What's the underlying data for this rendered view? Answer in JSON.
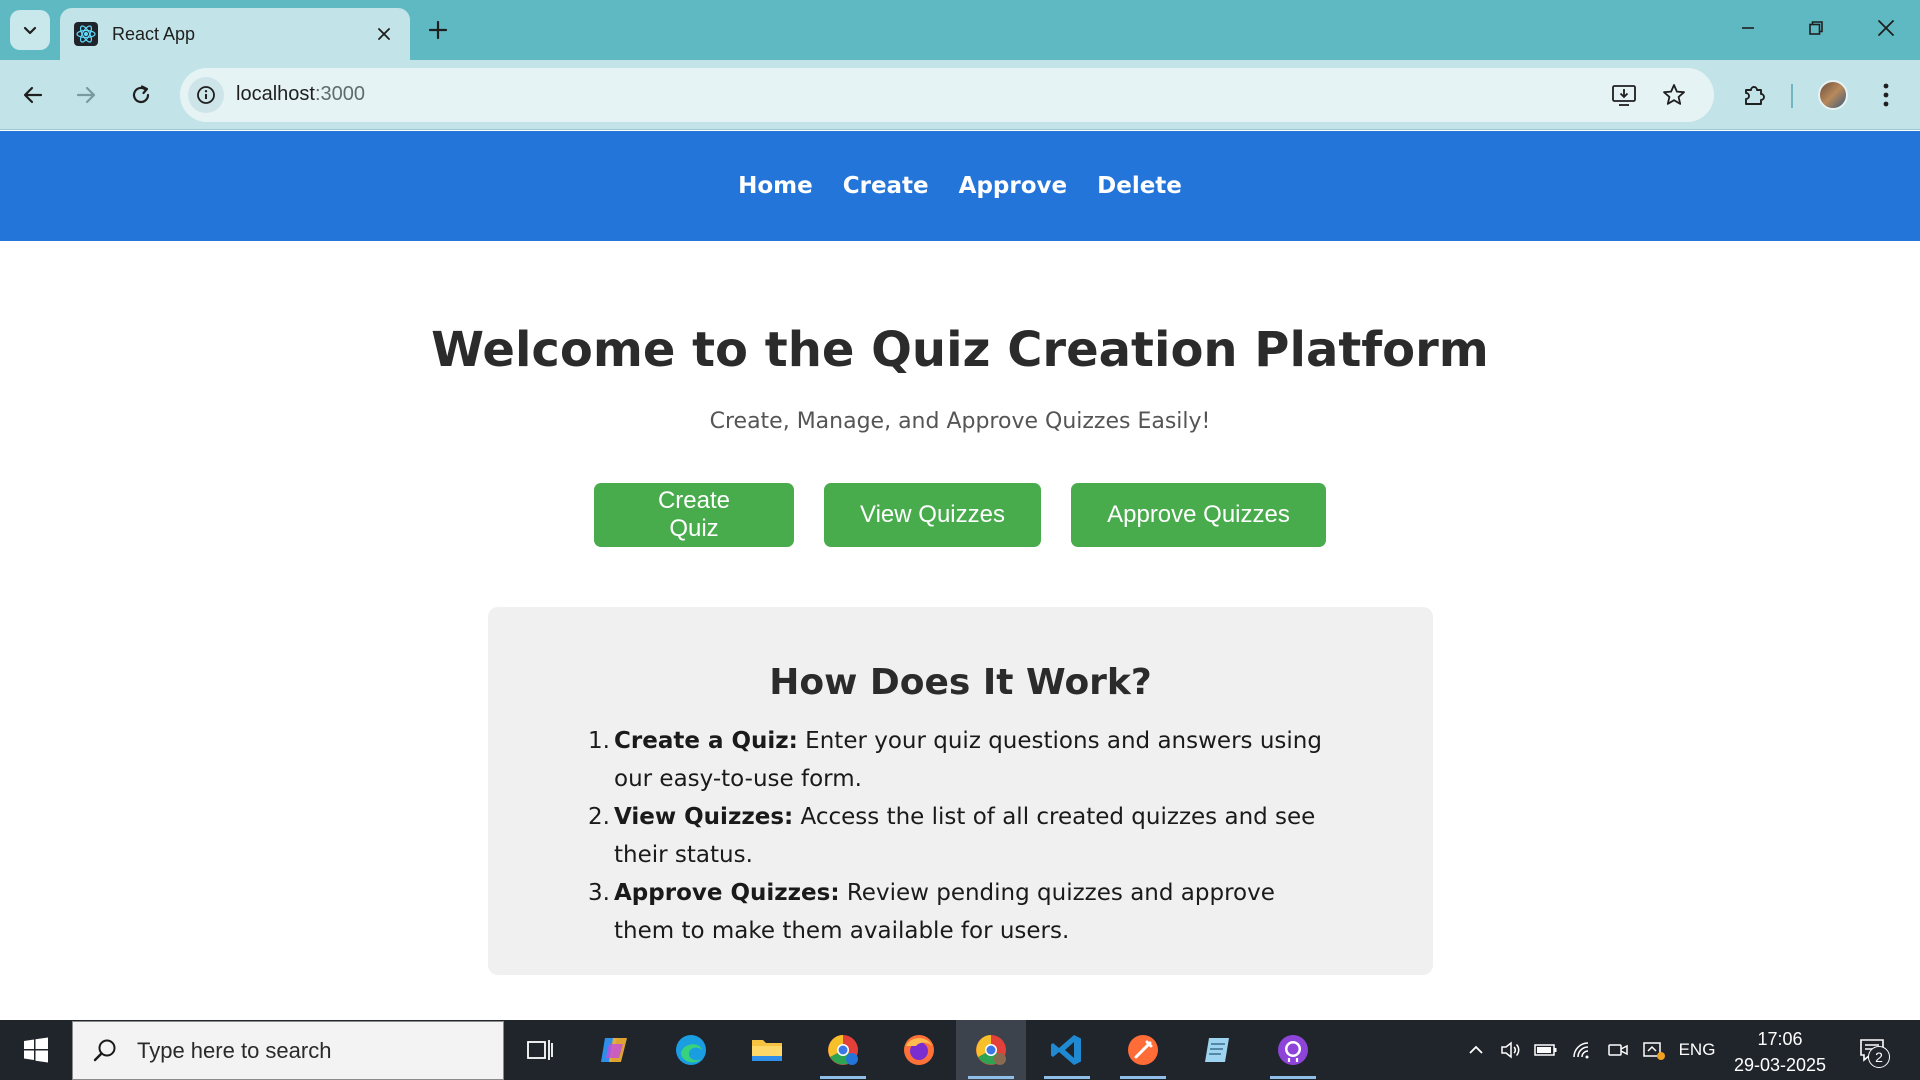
{
  "browser": {
    "tab": {
      "title": "React App",
      "favicon": "react-icon"
    },
    "url": {
      "host": "localhost",
      "port": ":3000"
    },
    "colors": {
      "tabbar": "#5fb9c2",
      "toolbar": "#c2e4e8"
    }
  },
  "app": {
    "nav": {
      "links": [
        "Home",
        "Create",
        "Approve",
        "Delete"
      ],
      "background": "#2475d9"
    },
    "hero": {
      "title": "Welcome to the Quiz Creation Platform",
      "subtitle": "Create, Manage, and Approve Quizzes Easily!",
      "buttons": [
        "Create Quiz",
        "View Quizzes",
        "Approve Quizzes"
      ],
      "button_color": "#48ac4d"
    },
    "how": {
      "title": "How Does It Work?",
      "steps": [
        {
          "num": "1.",
          "label": "Create a Quiz:",
          "text": " Enter your quiz questions and answers using our easy-to-use form."
        },
        {
          "num": "2.",
          "label": "View Quizzes:",
          "text": " Access the list of all created quizzes and see their status."
        },
        {
          "num": "3.",
          "label": "Approve Quizzes:",
          "text": " Review pending quizzes and approve them to make them available for users."
        }
      ]
    }
  },
  "taskbar": {
    "search_placeholder": "Type here to search",
    "apps": [
      "task-view-icon",
      "copilot-icon",
      "edge-icon",
      "file-explorer-icon",
      "chrome-profile-icon",
      "firefox-icon",
      "chrome-icon",
      "vscode-icon",
      "postman-icon",
      "notepad-icon",
      "github-desktop-icon"
    ],
    "language": "ENG",
    "time": "17:06",
    "date": "29-03-2025",
    "notification_count": "2"
  }
}
